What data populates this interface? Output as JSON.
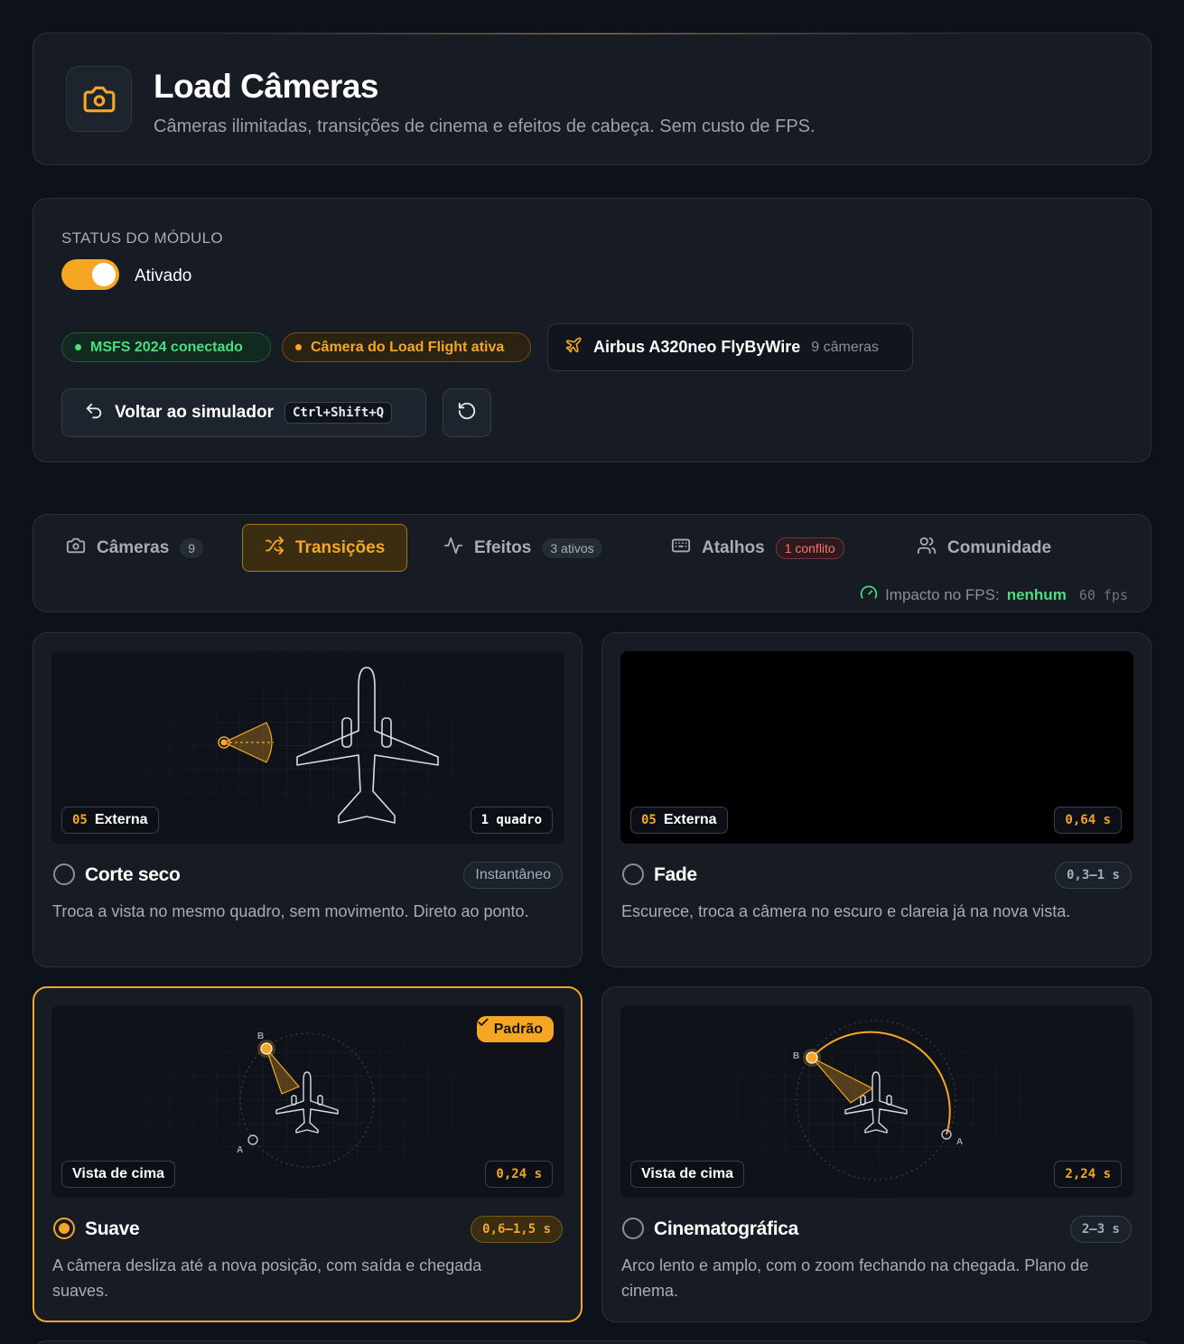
{
  "header": {
    "title": "Load Câmeras",
    "subtitle": "Câmeras ilimitadas, transições de cinema e efeitos de cabeça. Sem custo de FPS.",
    "icon": "camera-icon",
    "accent": "#f5a623"
  },
  "status": {
    "label": "STATUS DO MÓDULO",
    "toggle_on": true,
    "toggle_label": "Ativado",
    "pill_connected": "MSFS 2024 conectado",
    "pill_camera": "Câmera do Load Flight ativa",
    "aircraft_name": "Airbus A320neo FlyByWire",
    "aircraft_cameras": "9 câmeras",
    "back_label": "Voltar ao simulador",
    "back_shortcut": "Ctrl+Shift+Q"
  },
  "tabs": [
    {
      "label": "Câmeras",
      "badge": "9",
      "icon": "camera-icon"
    },
    {
      "label": "Transições",
      "badge": "",
      "icon": "shuffle-icon",
      "active": true
    },
    {
      "label": "Efeitos",
      "badge": "3 ativos",
      "icon": "activity-icon"
    },
    {
      "label": "Atalhos",
      "badge": "1 conflito",
      "icon": "keyboard-icon"
    },
    {
      "label": "Comunidade",
      "badge": "",
      "icon": "users-icon"
    }
  ],
  "fps": {
    "label": "Impacto no FPS:",
    "value": "nenhum",
    "fps": "60 fps"
  },
  "transitions": [
    {
      "name": "Corte seco",
      "duration": "Instantâneo",
      "description": "Troca a vista no mesmo quadro, sem movimento. Direto ao ponto.",
      "view_num": "05",
      "view": "Externa",
      "preview_value": "1 quadro",
      "selected": false
    },
    {
      "name": "Fade",
      "duration": "0,3–1 s",
      "description": "Escurece, troca a câmera no escuro e clareia já na nova vista.",
      "view_num": "05",
      "view": "Externa",
      "preview_value": "0,64 s",
      "selected": false
    },
    {
      "name": "Suave",
      "duration": "0,6–1,5 s",
      "description": "A câmera desliza até a nova posição, com saída e chegada suaves.",
      "view": "Vista de cima",
      "preview_value": "0,24 s",
      "default_label": "Padrão",
      "point_a": "A",
      "point_b": "B",
      "selected": true
    },
    {
      "name": "Cinematográfica",
      "duration": "2–3 s",
      "description": "Arco lento e amplo, com o zoom fechando na chegada. Plano de cinema.",
      "view": "Vista de cima",
      "preview_value": "2,24 s",
      "point_a": "A",
      "point_b": "B",
      "selected": false
    }
  ]
}
